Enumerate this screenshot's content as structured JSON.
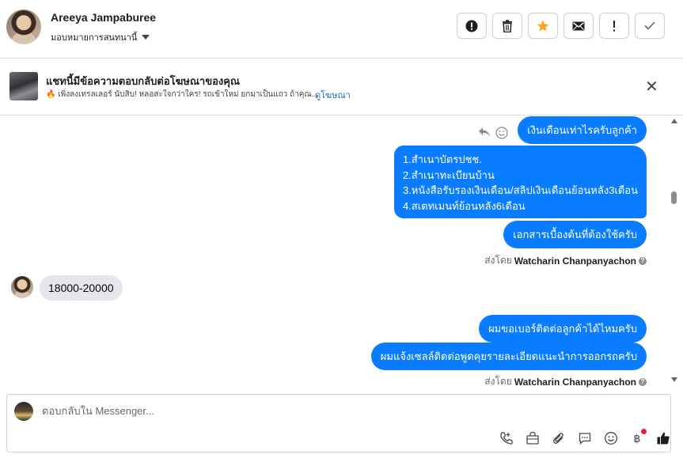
{
  "header": {
    "name": "Areeya Jampaburee",
    "assign_label": "มอบหมายการสนทนานี้"
  },
  "ad": {
    "title": "แชทนี้มีข้อความตอบกลับต่อโฆษณาของคุณ",
    "subtitle": "🔥 เพิ่งลงเทรลเลอร์ นับสิบ! หลอสะใจกว่าใคร! รถเข้าใหม่ ยกมาเป็นแถว ถ้าคุณ...",
    "link": "ดูโฆษณา"
  },
  "messages": {
    "m1": "เงินเดือนเท่าไรครับลูกค้า",
    "m2_lines": [
      "1.สำเนาบัตรปชช.",
      "2.สำเนาทะเบียนบ้าน",
      "3.หนังสือรับรองเงินเดือน/สลิปเงินเดือนย้อนหลัง3เดือน",
      "4.สเตทเมนท์ย้อนหลัง6เดือน"
    ],
    "m3": "เอกสารเบื้องต้นที่ต้องใช้ครับ",
    "sent_by_label": "ส่งโดย",
    "sent_by_name": "Watcharin Chanpanyachon",
    "incoming": "18000-20000",
    "m4": "ผมขอเบอร์ติดต่อลูกค้าได้ไหมครับ",
    "m5": "ผมแจ้งเซลล์ติดต่อพูดคุยรายละเอียดแนะนำการออกรถครับ"
  },
  "composer": {
    "placeholder": "ตอบกลับใน Messenger..."
  },
  "colors": {
    "outgoing_bubble": "#0a7cff",
    "incoming_bubble": "#e4e6eb",
    "star": "#f5a623",
    "link": "#1a66c2",
    "notification_dot": "#e41e3f"
  }
}
